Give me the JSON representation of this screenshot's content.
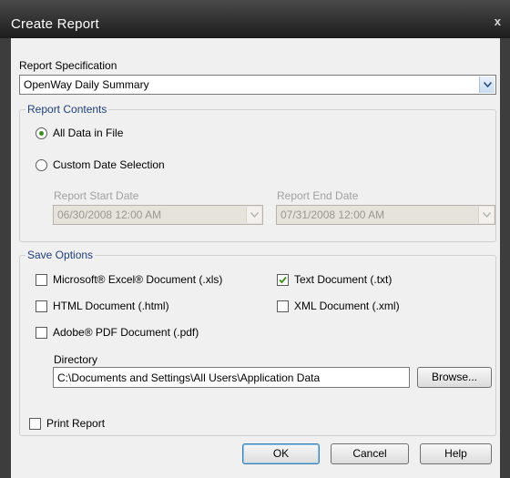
{
  "window": {
    "title": "Create Report",
    "close_glyph": "x"
  },
  "report_spec": {
    "label": "Report Specification",
    "value": "OpenWay Daily Summary"
  },
  "report_contents": {
    "legend": "Report Contents",
    "options": [
      {
        "label": "All Data in File",
        "selected": true
      },
      {
        "label": "Custom Date Selection",
        "selected": false
      }
    ],
    "start_date": {
      "label": "Report Start Date",
      "value": "06/30/2008 12:00 AM"
    },
    "end_date": {
      "label": "Report End Date",
      "value": "07/31/2008 12:00 AM"
    }
  },
  "save_options": {
    "legend": "Save Options",
    "checkboxes": [
      {
        "label": "Microsoft® Excel® Document (.xls)",
        "checked": false
      },
      {
        "label": "Text Document (.txt)",
        "checked": true
      },
      {
        "label": "HTML Document (.html)",
        "checked": false
      },
      {
        "label": "XML Document (.xml)",
        "checked": false
      },
      {
        "label": "Adobe® PDF Document (.pdf)",
        "checked": false
      }
    ],
    "directory_label": "Directory",
    "directory_value": "C:\\Documents and Settings\\All Users\\Application Data",
    "browse_label": "Browse..."
  },
  "print_report": {
    "label": "Print Report",
    "checked": false
  },
  "buttons": {
    "ok": "OK",
    "cancel": "Cancel",
    "help": "Help"
  },
  "colors": {
    "titlebar": "#2a2a2a",
    "dialog_bg": "#f0f0f0",
    "group_legend": "#1f3f7a",
    "radio_selected": "#3a8e1e",
    "check_mark": "#3a8e1e"
  },
  "icons": {
    "dropdown": "chevron-down-icon",
    "close": "close-icon",
    "check": "check-icon"
  }
}
